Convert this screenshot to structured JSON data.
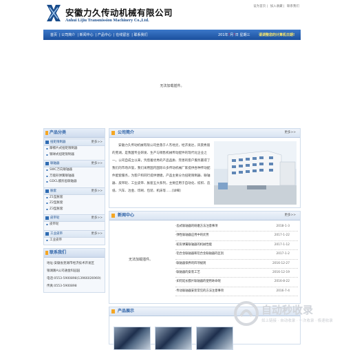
{
  "company": {
    "name_cn": "安徽力久传动机械有限公司",
    "name_en": "Anhui Lijiu Transmission Machinery Co.,Ltd."
  },
  "toplinks": [
    "设为首页",
    "加入收藏",
    "联系我们"
  ],
  "nav": {
    "items": [
      "首页",
      "公司简介",
      "新闻中心",
      "产品中心",
      "在线留言",
      "联系我们"
    ],
    "date": {
      "pre": "201",
      "y": "年",
      "m": "月",
      "d": "日",
      "w": "星期三"
    },
    "slogan": "请调整您的计算机日期!"
  },
  "flash_text": "无法加载插件。",
  "sidebar": {
    "title": "产品分类",
    "categories": [
      {
        "title": "扭矩限制器",
        "more": "更多>>",
        "items": [
          "摩擦片式扭矩限制器",
          "钢球式扭矩限制器"
        ]
      },
      {
        "title": "联轴器",
        "more": "更多>>",
        "items": [
          "SWC万向联轴器",
          "万能形弹簧联轴器",
          "GDCL膜形齿联轴器"
        ]
      },
      {
        "title": "胀套",
        "more": "更多>>",
        "items": [
          "Z1型胀套",
          "Z2型胀套",
          "Z3型胀套"
        ]
      },
      {
        "title": "皮带轮",
        "more": "更多>>",
        "items": [
          "皮带轮"
        ]
      },
      {
        "title": "工业皮带",
        "more": "更多>>",
        "items": [
          "工业皮带"
        ]
      }
    ]
  },
  "contact": {
    "title": "联系我们",
    "lines": [
      "地址:安徽省芜湖市经济技术开发区",
      "银湖路A公司通金科园园",
      "电话:0553-5900898(13966026969)",
      "传真:0553-5900898"
    ]
  },
  "about": {
    "title": "公司简介",
    "more": "更多>>",
    "text": "安徽力久传动机械有限公司坐落于人杰地灵，经济发达，风景秀丽的芜湖，是我国专业研发、生产与销售机械传动配件的现代化企业之一。公司自成立以来，凭借着优秀的产品品质、完善的客户服务赢得了我们的市场声誉，我们采用国内国际众多传动机械厂家提供各种传动配件配套服务，为客户和同行提供便捷。产品主要分为扭矩限制器、联轴器、皮带轮、工业皮带、胀套五大系列，主要应用于自动化、纺织、造纸、汽车、冶金、印刷、包装、机床等......[详细]"
  },
  "news": {
    "title": "新闻中心",
    "more": "更多>>",
    "left_text": "无法加载插件。",
    "items": [
      {
        "title": "·齿式联轴器的研磨方法注意事项",
        "date": "2018-1-3"
      },
      {
        "title": "·弹性联轴器应用中的优势",
        "date": "2017-1-22"
      },
      {
        "title": "·蛇形弹簧联轴器的机械性能",
        "date": "2017-1-12"
      },
      {
        "title": "·铝合金联轴器和铝合金联轴器的区别",
        "date": "2017-1-2"
      },
      {
        "title": "·联轴器保养的四项规则",
        "date": "2016-12-27"
      },
      {
        "title": "·联轴器的安装工艺",
        "date": "2016-12-19"
      },
      {
        "title": "·如何延长膜片联轴器的使用寿命呢",
        "date": "2016-8-22"
      },
      {
        "title": "·传动联轴器安装常见的方法注意事项",
        "date": "2016-7-4"
      }
    ]
  },
  "products": {
    "title": "产品展示"
  },
  "watermark": {
    "title": "自动秒收录",
    "sub": "如上链接 · 自动收录 · 一次收录 · 极速收录"
  }
}
